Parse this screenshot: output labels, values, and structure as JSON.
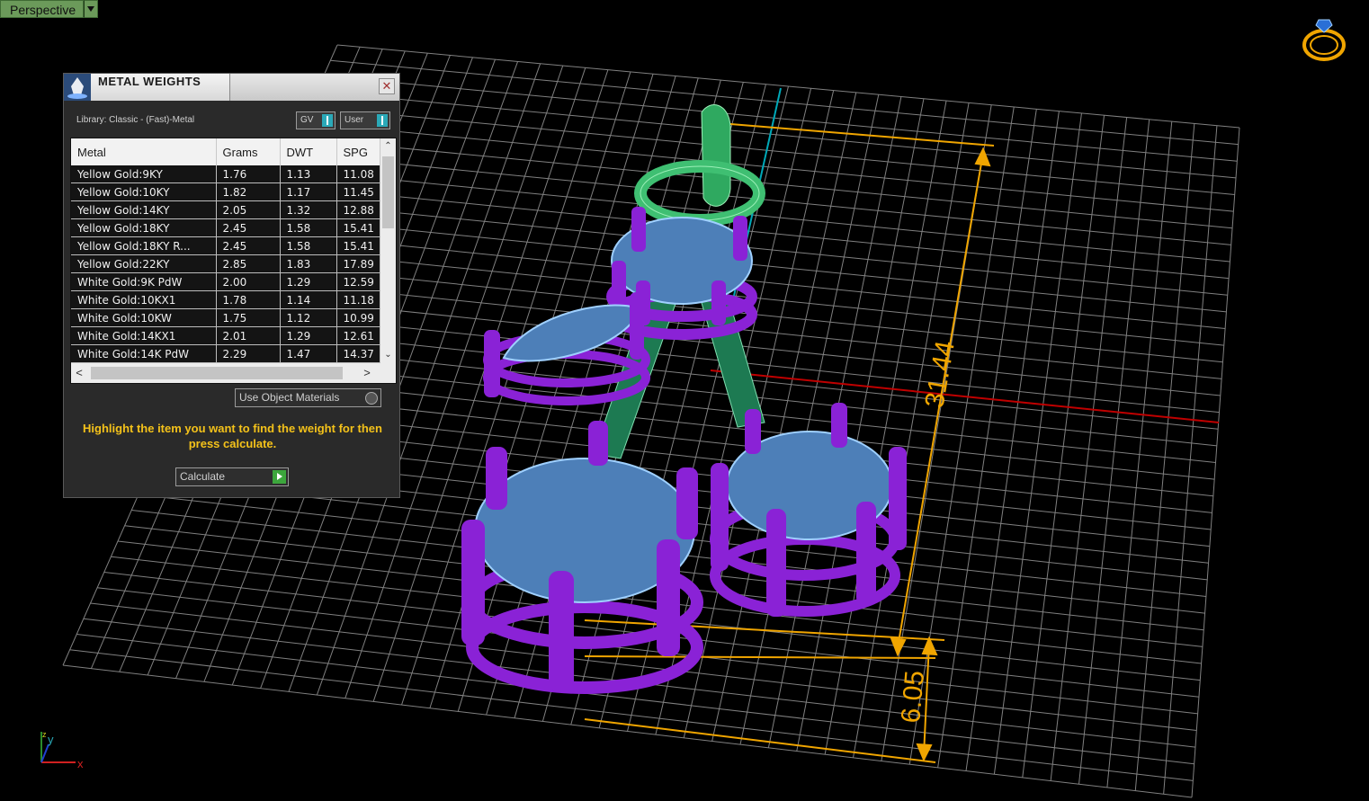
{
  "viewport": {
    "label": "Perspective",
    "dimensions": [
      "31.44",
      "6.05"
    ],
    "colors": {
      "grid": "#7a7a7a",
      "dimension": "#f0a500",
      "prongs": "#8a22d6",
      "gems": "#8cc8ff",
      "bail": "#3fbf72"
    }
  },
  "panel": {
    "title": "METAL WEIGHTS",
    "close_glyph": "✕",
    "library": "Library: Classic - (Fast)-Metal",
    "toggle_gv": "GV",
    "toggle_user": "User",
    "columns": [
      "Metal",
      "Grams",
      "DWT",
      "SPG"
    ],
    "rows": [
      [
        "Yellow Gold:9KY",
        "1.76",
        "1.13",
        "11.08"
      ],
      [
        "Yellow Gold:10KY",
        "1.82",
        "1.17",
        "11.45"
      ],
      [
        "Yellow Gold:14KY",
        "2.05",
        "1.32",
        "12.88"
      ],
      [
        "Yellow Gold:18KY",
        "2.45",
        "1.58",
        "15.41"
      ],
      [
        "Yellow Gold:18KY R...",
        "2.45",
        "1.58",
        "15.41"
      ],
      [
        "Yellow Gold:22KY",
        "2.85",
        "1.83",
        "17.89"
      ],
      [
        "White Gold:9K PdW",
        "2.00",
        "1.29",
        "12.59"
      ],
      [
        "White Gold:10KX1",
        "1.78",
        "1.14",
        "11.18"
      ],
      [
        "White Gold:10KW",
        "1.75",
        "1.12",
        "10.99"
      ],
      [
        "White Gold:14KX1",
        "2.01",
        "1.29",
        "12.61"
      ],
      [
        "White Gold:14K PdW",
        "2.29",
        "1.47",
        "14.37"
      ]
    ],
    "scroll_up": "⌃",
    "scroll_down": "⌄",
    "scroll_left": "<",
    "scroll_right": ">",
    "use_object_materials": "Use Object Materials",
    "hint": "Highlight the item you want to find the weight for then press calculate.",
    "calculate": "Calculate"
  },
  "axis": {
    "x": "x",
    "y": "y",
    "z": "z"
  }
}
